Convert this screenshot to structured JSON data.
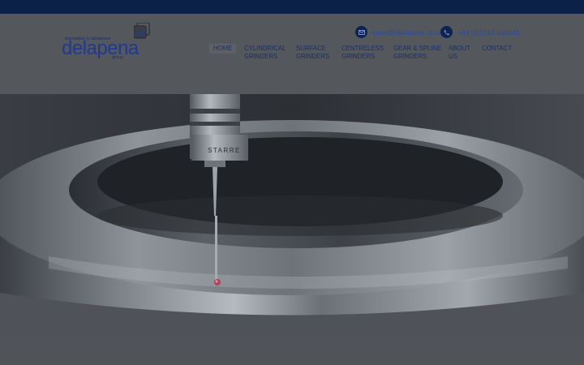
{
  "header": {
    "logo": {
      "tagline": "innovation in abrasives",
      "wordmark": "delapena",
      "sub": "group",
      "badge": "dg"
    },
    "email": {
      "text": "sales@delapena.co.uk",
      "icon": "envelope-icon"
    },
    "phone": {
      "text": "+44 (0)1242 516341",
      "icon": "phone-icon"
    }
  },
  "nav": {
    "items": [
      {
        "line1": "HOME",
        "line2": ""
      },
      {
        "line1": "CYLINDRICAL",
        "line2": "GRINDERS"
      },
      {
        "line1": "SURFACE",
        "line2": "GRINDERS"
      },
      {
        "line1": "CENTRELESS",
        "line2": "GRINDERS"
      },
      {
        "line1": "GEAR & SPLINE",
        "line2": "GRINDERS"
      },
      {
        "line1": "ABOUT",
        "line2": "US"
      },
      {
        "line1": "CONTACT",
        "line2": ""
      }
    ]
  },
  "hero": {
    "probe_text": "STARRE"
  },
  "colors": {
    "topbar": "#0c2148",
    "header_bg": "#54575c",
    "accent": "#2b4aa6",
    "brand_dark": "#1b2f66"
  }
}
